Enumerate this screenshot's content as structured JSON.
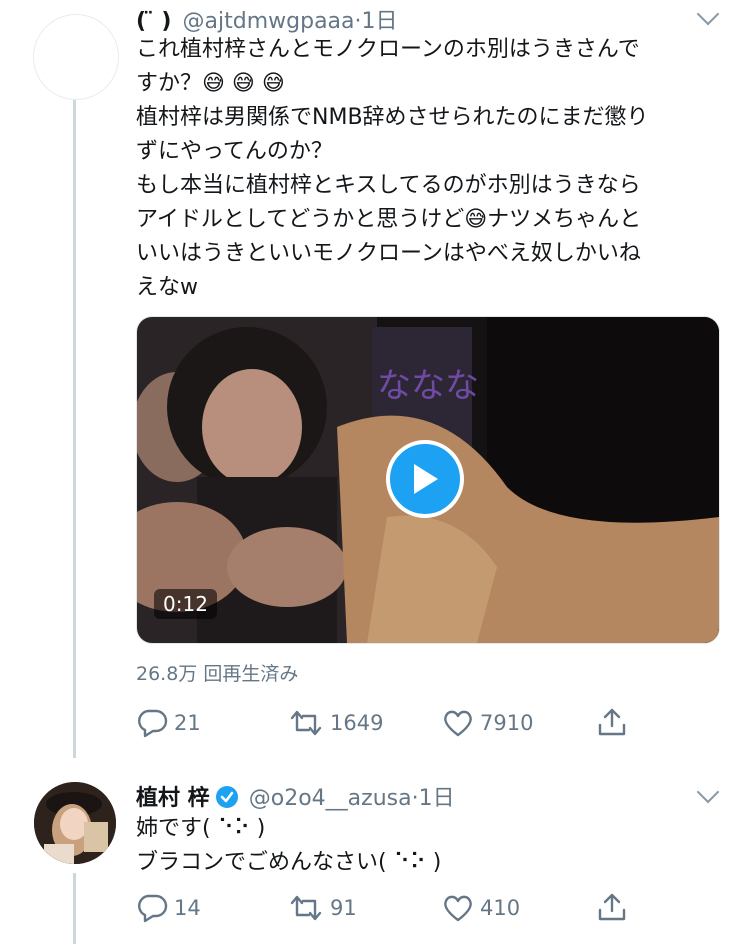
{
  "tweet1": {
    "display_name": "( ̈ )",
    "handle": "@ajtdmwgpaaa",
    "time": "·1日",
    "lines": [
      "これ植村梓さんとモノクローンのホ別はうきさんで",
      "すか？😅 😅 😅",
      "植村梓は男関係でNMB辞めさせられたのにまだ懲り",
      "ずにやってんのか？",
      "もし本当に植村梓とキスしてるのがホ別はうきなら",
      "アイドルとしてどうかと思うけど😅ナツメちゃんと",
      "いいはうきといいモノクローンはやべえ奴しかいね",
      "えなw"
    ],
    "video_duration": "0:12",
    "views": "26.8万 回再生済み",
    "actions": {
      "replies": "21",
      "retweets": "1649",
      "likes": "7910"
    }
  },
  "tweet2": {
    "display_name": "植村 梓",
    "handle": "@o2o4__azusa",
    "time": "·1日",
    "lines": [
      "姉です( ⠑⠕ )",
      "ブラコンでごめんなさい( ⠑⠕ )"
    ],
    "actions": {
      "replies": "14",
      "retweets": "91",
      "likes": "410"
    }
  },
  "colors": {
    "accent": "#1da1f2",
    "muted": "#657786",
    "line": "#ccd6dd"
  }
}
